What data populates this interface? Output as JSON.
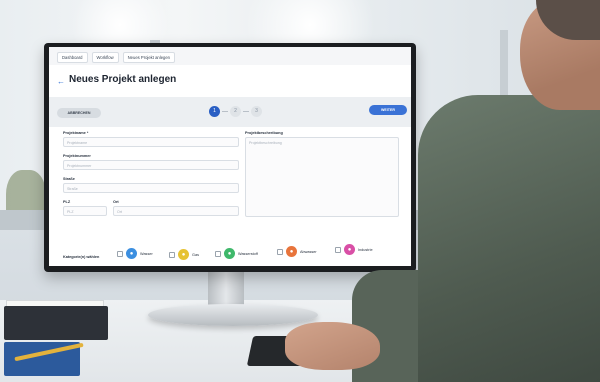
{
  "breadcrumb": [
    "Dashboard",
    "Workflow",
    "Neues Projekt anlegen"
  ],
  "header": {
    "title": "Neues Projekt anlegen",
    "back_icon": "arrow-left-icon"
  },
  "stepper": {
    "cancel_label": "ABBRECHEN",
    "next_label": "WEITER",
    "steps": [
      "1",
      "2",
      "3"
    ],
    "active_step": 1
  },
  "form": {
    "projektname": {
      "label": "Projektname *",
      "placeholder": "Projektname"
    },
    "projektnummer": {
      "label": "Projektnummer",
      "placeholder": "Projektnummer"
    },
    "strasse": {
      "label": "Straße",
      "placeholder": "Straße"
    },
    "plz": {
      "label": "PLZ",
      "placeholder": "PLZ"
    },
    "ort": {
      "label": "Ort",
      "placeholder": "Ort"
    },
    "beschreibung": {
      "label": "Projektbeschreibung",
      "placeholder": "Projektbeschreibung"
    }
  },
  "categories": {
    "label": "Kategorie(n) wählen",
    "items": [
      {
        "label": "Wasser",
        "icon": "water-drop-icon",
        "color": "#3c8fe0"
      },
      {
        "label": "Gas",
        "icon": "flame-icon",
        "color": "#e6c233"
      },
      {
        "label": "Wasserstoff",
        "icon": "molecule-icon",
        "color": "#3fb86b"
      },
      {
        "label": "Abwasser",
        "icon": "drain-icon",
        "color": "#e8743b"
      },
      {
        "label": "Industrie",
        "icon": "factory-icon",
        "color": "#d94fa6"
      }
    ]
  },
  "colors": {
    "accent": "#3a72d6",
    "active_step": "#2a5fc4"
  }
}
